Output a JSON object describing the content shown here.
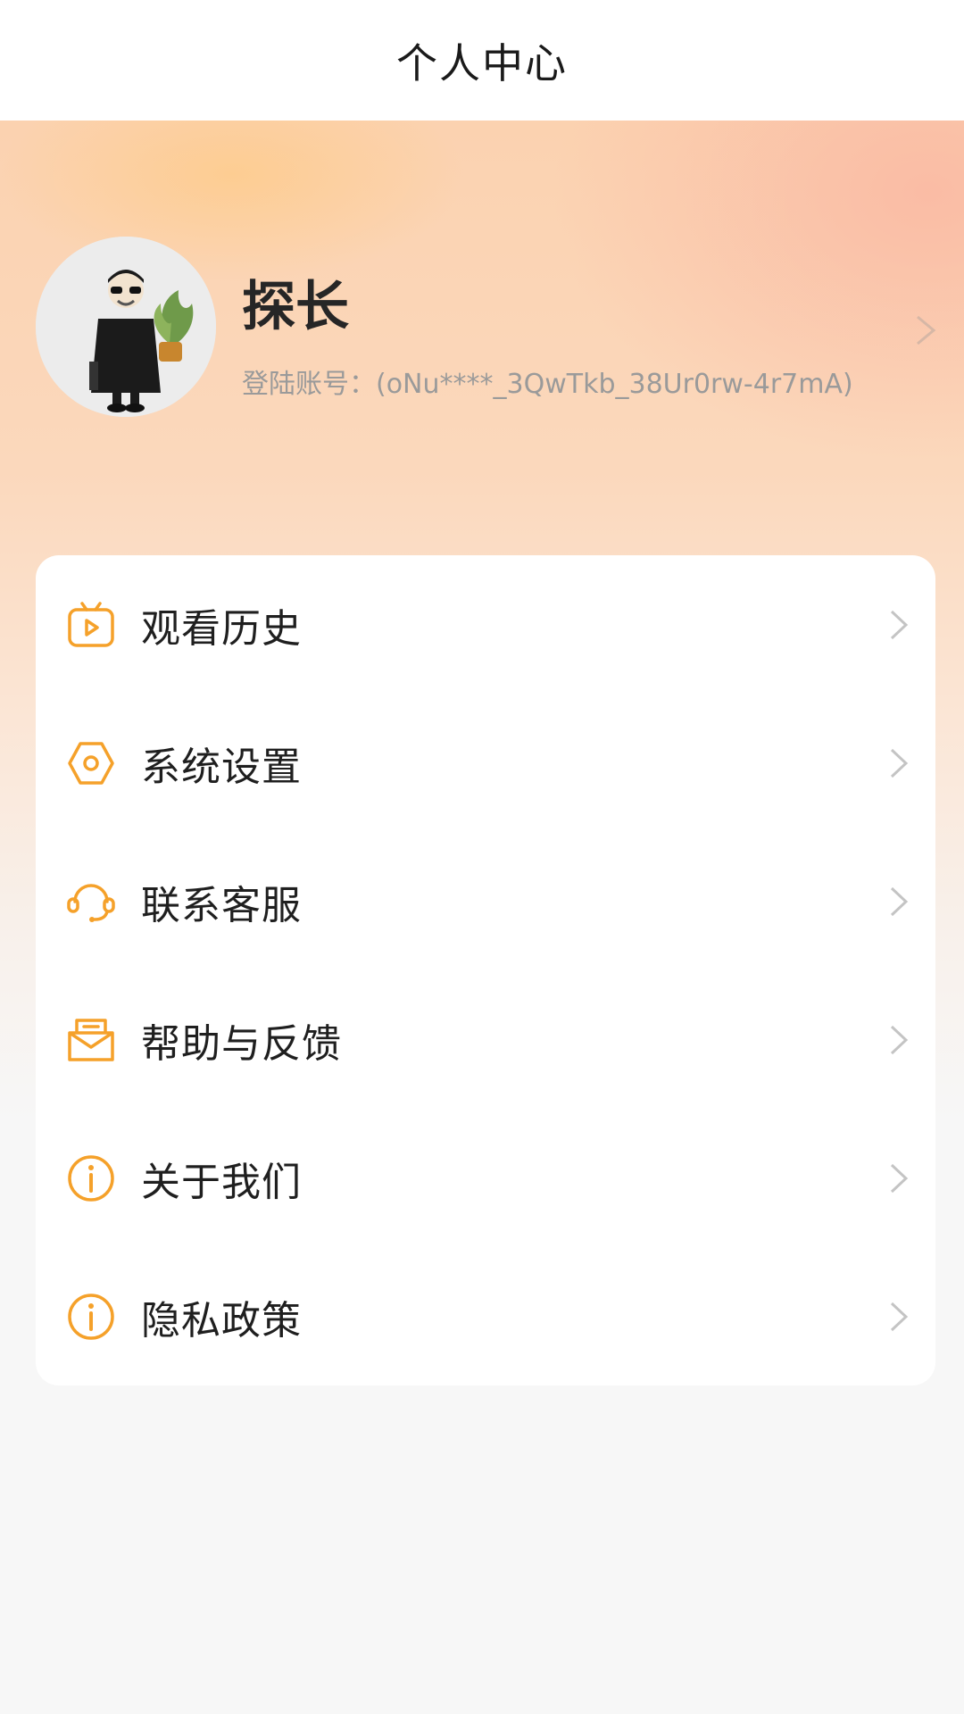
{
  "header": {
    "title": "个人中心"
  },
  "profile": {
    "name": "探长",
    "account": "登陆账号：(oNu****_3QwTkb_38Ur0rw-4r7mA)"
  },
  "menu": [
    {
      "label": "观看历史",
      "icon": "tv-play-icon"
    },
    {
      "label": "系统设置",
      "icon": "settings-hexagon-icon"
    },
    {
      "label": "联系客服",
      "icon": "headset-icon"
    },
    {
      "label": "帮助与反馈",
      "icon": "mail-feedback-icon"
    },
    {
      "label": "关于我们",
      "icon": "info-icon"
    },
    {
      "label": "隐私政策",
      "icon": "info-icon"
    }
  ],
  "colors": {
    "accent": "#f5a12a",
    "chevron": "#c4c4c4"
  }
}
